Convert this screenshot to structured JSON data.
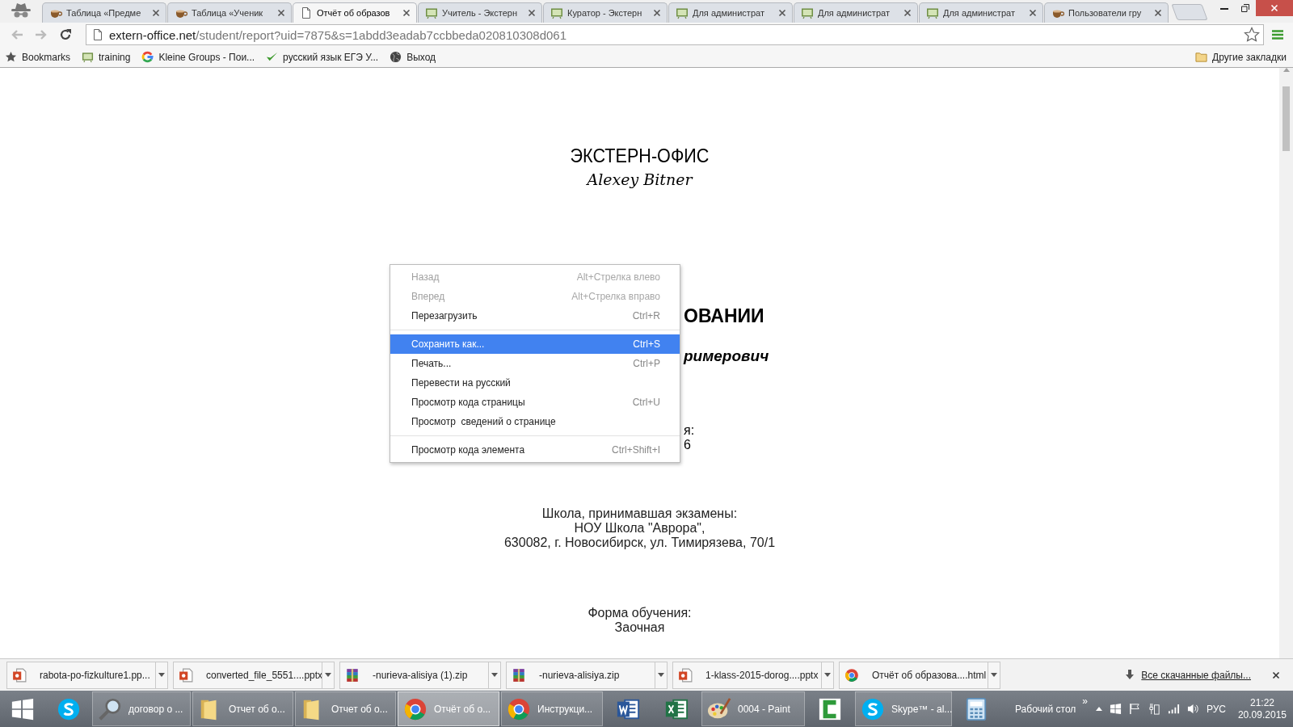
{
  "tabs": [
    {
      "title": "Таблица «Предме",
      "kind": "cup",
      "selected": false
    },
    {
      "title": "Таблица «Ученик",
      "kind": "cup",
      "selected": false
    },
    {
      "title": "Отчёт об образов",
      "kind": "page",
      "selected": true
    },
    {
      "title": "Учитель - Экстерн",
      "kind": "board",
      "selected": false
    },
    {
      "title": "Куратор - Экстерн",
      "kind": "board",
      "selected": false
    },
    {
      "title": "Для администрат",
      "kind": "board",
      "selected": false
    },
    {
      "title": "Для администрат",
      "kind": "board",
      "selected": false
    },
    {
      "title": "Для администрат",
      "kind": "board",
      "selected": false
    },
    {
      "title": "Пользователи гру",
      "kind": "cup",
      "selected": false
    }
  ],
  "address": {
    "host": "extern-office.net",
    "path": "/student/report?uid=7875&s=1abdd3eadab7ccbbeda020810308d061"
  },
  "bookmarks": [
    {
      "label": "Bookmarks",
      "kind": "star"
    },
    {
      "label": "training",
      "kind": "board"
    },
    {
      "label": "Kleine Groups - Пои...",
      "kind": "g"
    },
    {
      "label": "русский язык ЕГЭ У...",
      "kind": "check"
    },
    {
      "label": "Выход",
      "kind": "globe"
    }
  ],
  "other_bookmarks": "Другие закладки",
  "page": {
    "logo_title": "ЭКСТЕРН-ОФИС",
    "logo_signature": "Alexey Bitner",
    "heading_fragment": "ОВАНИИ",
    "name_fragment": "римерович",
    "line_fragments": [
      "я:",
      "6"
    ],
    "school": [
      "Школа, принимавшая экзамены:",
      "НОУ Школа \"Аврора\",",
      "630082, г. Новосибирск, ул. Тимирязева, 70/1"
    ],
    "study_form": [
      "Форма обучения:",
      "Заочная"
    ]
  },
  "context_menu": {
    "groups": [
      {
        "items": [
          {
            "label": "Назад",
            "shortcut": "Alt+Стрелка влево",
            "disabled": true,
            "selected": false
          },
          {
            "label": "Вперед",
            "shortcut": "Alt+Стрелка вправо",
            "disabled": true,
            "selected": false
          },
          {
            "label": "Перезагрузить",
            "shortcut": "Ctrl+R",
            "disabled": false,
            "selected": false
          }
        ]
      },
      {
        "items": [
          {
            "label": "Сохранить как...",
            "shortcut": "Ctrl+S",
            "disabled": false,
            "selected": true
          },
          {
            "label": "Печать...",
            "shortcut": "Ctrl+P",
            "disabled": false,
            "selected": false
          },
          {
            "label": "Перевести на русский",
            "disabled": false,
            "selected": false
          },
          {
            "label": "Просмотр кода страницы",
            "shortcut": "Ctrl+U",
            "disabled": false,
            "selected": false
          },
          {
            "label": "Просмотр  сведений о странице",
            "disabled": false,
            "selected": false
          }
        ]
      },
      {
        "items": [
          {
            "label": "Просмотр кода элемента",
            "shortcut": "Ctrl+Shift+I",
            "disabled": false,
            "selected": false
          }
        ]
      }
    ]
  },
  "downloads": {
    "items": [
      {
        "name": "rabota-po-fizkulture1.pp...",
        "kind": "ppt"
      },
      {
        "name": "converted_file_5551....pptx",
        "kind": "ppt"
      },
      {
        "name": "-nurieva-alisiya (1).zip",
        "kind": "zip"
      },
      {
        "name": "-nurieva-alisiya.zip",
        "kind": "zip"
      },
      {
        "name": "1-klass-2015-dorog....pptx",
        "kind": "ppt"
      },
      {
        "name": "Отчёт об образова....html",
        "kind": "browser"
      }
    ],
    "all_link": "Все скачанные файлы..."
  },
  "taskbar": {
    "items": [
      {
        "kind": "start",
        "active": false
      },
      {
        "kind": "skype",
        "active": false
      },
      {
        "kind": "search",
        "label": "договор о ...",
        "active": false
      },
      {
        "kind": "folder",
        "label": "Отчет об о...",
        "active": false
      },
      {
        "kind": "folder",
        "label": "Отчет об о...",
        "active": false
      },
      {
        "kind": "browser",
        "label": "Отчёт об о...",
        "active": true
      },
      {
        "kind": "browser",
        "label": "Инструкци...",
        "active": false
      },
      {
        "kind": "word",
        "active": false
      },
      {
        "kind": "excel",
        "active": false
      },
      {
        "kind": "paint",
        "label": "0004 - Paint",
        "active": false
      },
      {
        "kind": "camtasia",
        "active": false
      },
      {
        "kind": "skype",
        "label": "Skype™ - al...",
        "active": false
      },
      {
        "kind": "calc",
        "active": false
      }
    ],
    "desktop": "Рабочий стол",
    "more": "»",
    "language": "РУС",
    "time": "21:22",
    "date": "20.09.2015"
  }
}
